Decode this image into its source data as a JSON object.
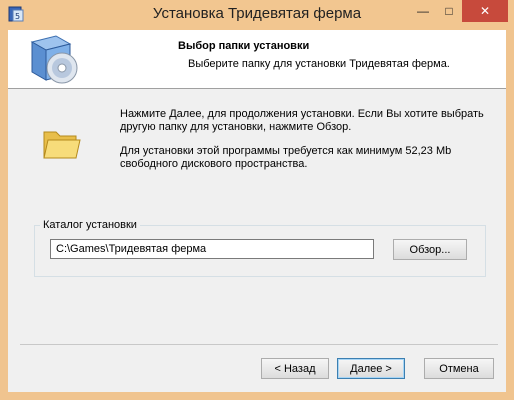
{
  "window": {
    "title": "Установка Тридевятая ферма",
    "minimize_glyph": "—",
    "maximize_glyph": "□",
    "close_glyph": "✕"
  },
  "header": {
    "title": "Выбор папки установки",
    "subtitle": "Выберите папку для установки Тридевятая ферма."
  },
  "body": {
    "intro": "Нажмите Далее, для продолжения установки. Если Вы хотите выбрать другую папку для установки, нажмите Обзор.",
    "space_note": "Для установки этой программы требуется как минимум 52,23 Mb свободного дискового пространства."
  },
  "install_dir": {
    "group_label": "Каталог установки",
    "path_value": "C:\\Games\\Тридевятая ферма",
    "browse_label": "Обзор..."
  },
  "footer": {
    "back_label": "< Назад",
    "next_label": "Далее >",
    "cancel_label": "Отмена"
  },
  "icons": {
    "app": "installer-app-icon",
    "header": "installer-box-cd-icon",
    "folder": "folder-icon"
  },
  "colors": {
    "frame": "#f0c48f",
    "close_button": "#c74a3c",
    "dialog_bg": "#f0f0f0",
    "folder": "#f3d46a"
  }
}
